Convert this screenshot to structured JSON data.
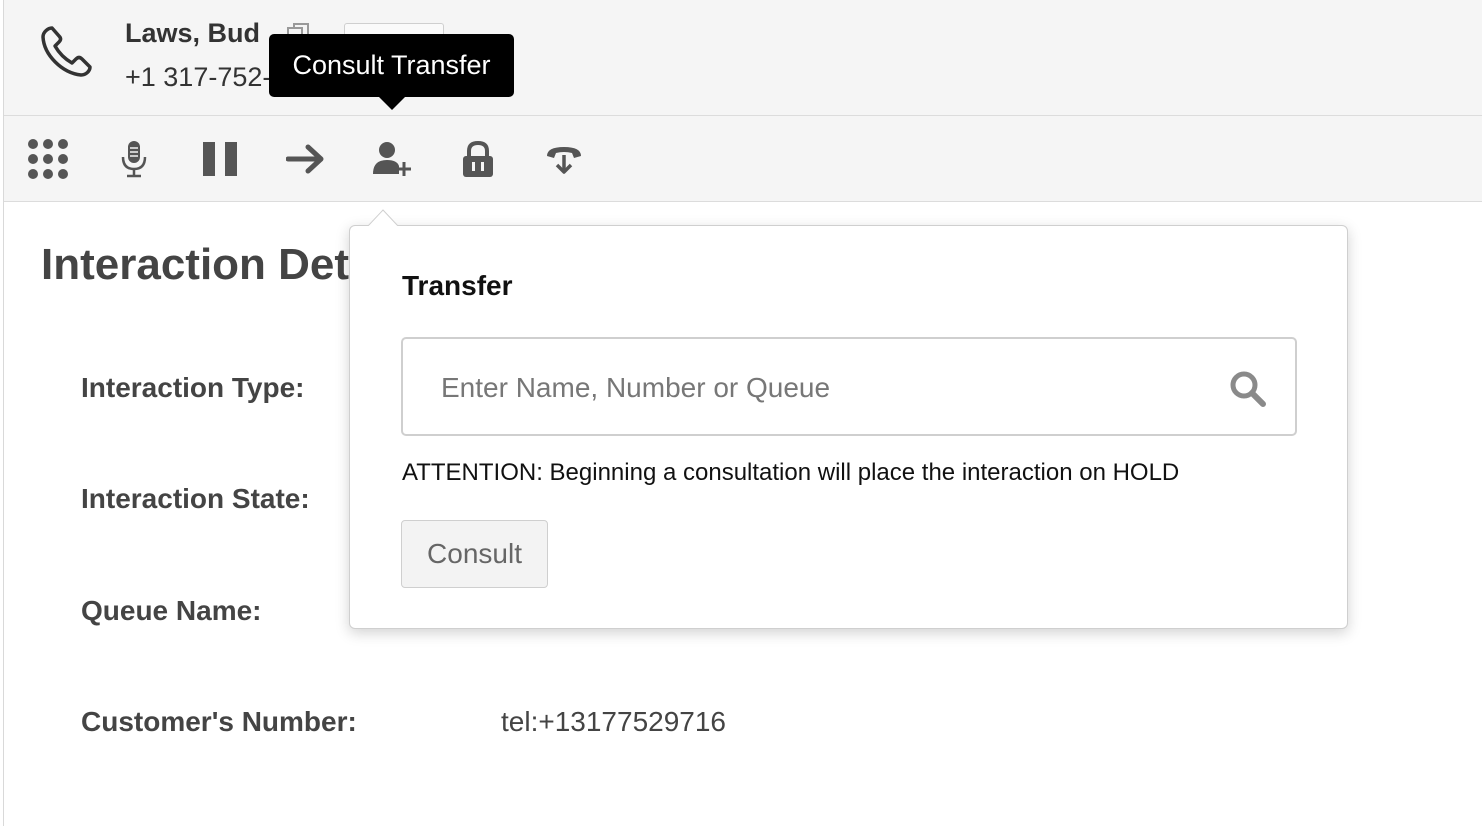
{
  "header": {
    "contact_name": "Laws, Bud",
    "contact_number": "+1 317-752-"
  },
  "toolbar": {
    "tools": [
      {
        "name": "dialpad-icon"
      },
      {
        "name": "microphone-icon"
      },
      {
        "name": "pause-icon"
      },
      {
        "name": "arrow-right-icon"
      },
      {
        "name": "add-person-icon"
      },
      {
        "name": "lock-icon"
      },
      {
        "name": "hangup-icon"
      }
    ],
    "tooltip": "Consult Transfer"
  },
  "details": {
    "title": "Interaction Deta",
    "rows": [
      {
        "label": "Interaction Type:",
        "value": ""
      },
      {
        "label": "Interaction State:",
        "value": ""
      },
      {
        "label": "Queue Name:",
        "value": ""
      },
      {
        "label": "Customer's Number:",
        "value": "tel:+13177529716"
      }
    ]
  },
  "transfer_popover": {
    "title": "Transfer",
    "search_placeholder": "Enter Name, Number or Queue",
    "attention_text": "ATTENTION: Beginning a consultation will place the interaction on HOLD",
    "consult_label": "Consult"
  },
  "colors": {
    "header_bg": "#f5f5f5",
    "icon_gray": "#555555",
    "tooltip_bg": "#000000"
  }
}
